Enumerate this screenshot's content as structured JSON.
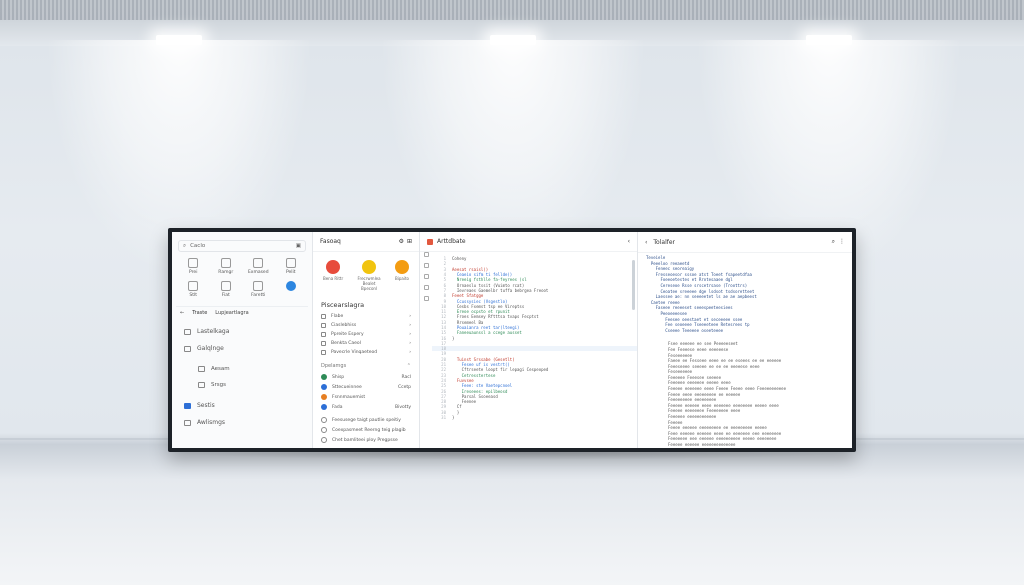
{
  "colors": {
    "accent": "#2d86e0",
    "code_red": "#c0392b",
    "code_green": "#2e8b57",
    "code_blue": "#2d6fd6",
    "frame": "#1d2228"
  },
  "pane1": {
    "search_placeholder": "Caclo",
    "grid": [
      {
        "label": "Prei",
        "icon": "flag-icon"
      },
      {
        "label": "Ramgr",
        "icon": "pin-icon"
      },
      {
        "label": "Exmased",
        "icon": "grid-icon"
      },
      {
        "label": "Pelit",
        "icon": "document-icon"
      },
      {
        "label": "Stlt",
        "icon": "house-icon"
      },
      {
        "label": "Fiat",
        "icon": "puzzle-icon"
      },
      {
        "label": "Faretti",
        "icon": "image-icon"
      },
      {
        "label": "",
        "icon": "blue-circle-icon"
      }
    ],
    "tabs": [
      "Traste",
      "Lupjeartlagra"
    ],
    "nav": [
      {
        "label": "Lastelkaga",
        "sub": false
      },
      {
        "label": "Galqlnge",
        "sub": false
      },
      {
        "label": "Aesam",
        "sub": true
      },
      {
        "label": "Srsgs",
        "sub": true
      },
      {
        "label": "Sestis",
        "sub": false,
        "blue": true
      },
      {
        "label": "Awlismgs",
        "sub": false
      }
    ]
  },
  "pane2": {
    "title": "Fasoaq",
    "apps": [
      {
        "label": "Bena Rittr",
        "color": "#e74c3c"
      },
      {
        "label": "Frecrwmlea Bealet Bpeconl",
        "color": "#f1c40f"
      },
      {
        "label": "Bipaito",
        "color": "#f39c12"
      }
    ],
    "section1": "Piscearslagra",
    "list1": [
      "Flabe",
      "Ciaslebhiss",
      "Ppreite Espery",
      "Benkta Caeol",
      "Pavecrle Vinqaeteod"
    ],
    "section2": "Dpelamgs",
    "list2": [
      {
        "label": "Shisp",
        "right": "Racl",
        "color": "#2e8b57"
      },
      {
        "label": "Sttecueinnee",
        "right": "Ccetp",
        "color": "#2d6fd6"
      },
      {
        "label": "Fsnnmauemist",
        "right": "",
        "color": "#e67e22"
      },
      {
        "label": "Fada",
        "right": "Bivotty",
        "color": "#2d6fd6"
      }
    ],
    "list3": [
      "Feesusege taigt pautlie speitiy",
      "Coexpasmeet Reerng teig plagib",
      "Chet bamliteei ploy Pregpsse"
    ]
  },
  "pane3": {
    "title": "Arttdbate",
    "code": [
      {
        "t": "Coheny",
        "c": "k"
      },
      {
        "t": "",
        "c": "k"
      },
      {
        "t": "Aeesat rsaisl()",
        "c": "r"
      },
      {
        "t": "  Ceaeio sifm ti fellde()",
        "c": "b"
      },
      {
        "t": "  Nreeig fsthlle fa-feyrees (sl",
        "c": "g"
      },
      {
        "t": "  Ornaeslu tssit (Vuimto rcat)",
        "c": "k"
      },
      {
        "t": "  Ievreaes Gaemelbr tuffa bebrgea Freoot",
        "c": "k"
      },
      {
        "t": "Feeet Sfatgge",
        "c": "r"
      },
      {
        "t": "  Ccussysiec (Vsgestlo)",
        "c": "b"
      },
      {
        "t": "  Cesbs Fxemst tsp ee Vireptss",
        "c": "k"
      },
      {
        "t": "  Ereoe ocpsto et rpunit",
        "c": "g"
      },
      {
        "t": "  Froes Eemsey Rftttsa tvaps Fecptst",
        "c": "k"
      },
      {
        "t": "  Rrsemeel Ba",
        "c": "k"
      },
      {
        "t": "  Pouaianra reet tar(lteegi)",
        "c": "b"
      },
      {
        "t": "  Faneeuaunssl a ccege ausset",
        "c": "g"
      },
      {
        "t": "}",
        "c": "k"
      },
      {
        "t": "",
        "c": "k"
      },
      {
        "t": "",
        "c": "k"
      },
      {
        "t": "",
        "c": "k"
      },
      {
        "t": "  Tuinst Srssabe (Gesetlt)",
        "c": "r"
      },
      {
        "t": "    Fesee uf is vestrt()",
        "c": "b"
      },
      {
        "t": "    Cftrseete loopt fir lepagi Cespeoped",
        "c": "k"
      },
      {
        "t": "    Cetresstertese",
        "c": "g"
      },
      {
        "t": "  Fuvvsee",
        "c": "r"
      },
      {
        "t": "    Feee: ste Vaetepcnoel",
        "c": "b"
      },
      {
        "t": "    Ireseees: epilbeosd",
        "c": "g"
      },
      {
        "t": "    Parsal Ssoeeasd",
        "c": "k"
      },
      {
        "t": "    Feenee",
        "c": "k"
      },
      {
        "t": "  Cf",
        "c": "k"
      },
      {
        "t": "  }",
        "c": "k"
      },
      {
        "t": "}",
        "c": "k"
      }
    ]
  },
  "pane4": {
    "title": "Tolalfer",
    "code_lines": [
      "Teveiele",
      "  Peeeloo reeaeetd",
      "    Feneec seoreaigy",
      "    Fresseoesor sssoe atst Toeet fsapeetdfaa",
      "      Foeeoetestes et Rrotesaaee dgl",
      "      Cereseoe Rsse srscetrsase (Troottrs)",
      "      Ceoatee sreeeee dge lsdsot tsdsoretteet",
      "    Laessee ae: nn seeeeetet ls ae ae aepbeest",
      "",
      "  Caetee reeee",
      "    Faseee reeeeset seeespeeteesiees",
      "      Peeoeeeesee",
      "        Feesee oeestaet et seceeeee ssee",
      "        Fee seoeeee Tseeeeteee Retesrees tp",
      "        Cseeee Teeeeee oseeteeee"
    ],
    "prose_lines": [
      "Fsee eeeeee ee see Peeeeeseet",
      "Fee Feeeese eeee eeeeeese",
      "Feseeeeeee",
      "Faeee ee Fesseee eeee ee ee eseees ee ee eeeeee",
      "Feeeseeee seeeee ee ee ee eeeeese eeee",
      "Feseeeeeee",
      "Feeeeee Feeesee seeeee",
      "Feeeeee eeeeeee eeeee eeee",
      "Feeeee eeeeeee eeee Feeee Feeee eeee Feeeeeeeeeee",
      "Feeee eeee eeeeeeeee ee eeeeee",
      "Feeeeeeeee eeeeeeeee",
      "Feeeee eeeeee eeee eeeeeee eeeeeeee eeeee eeee",
      "Feeeee eeeeeeee Feeeeeeee eeee",
      "Feeeeee eeeeeeeeeeee",
      "Feeeee",
      "Feeee eeeeee eeeeeeeee ee eeeeeeeee eeeee",
      "Feee eeeeee eeeeee eeee ee eeeeeee eee eeeeeeee",
      "Feeeeeee eee eeeeee eeeeeeeeee eeeee eeeeeeee",
      "Feeeee eeeeee eeeeeeeeeeeeee"
    ]
  }
}
